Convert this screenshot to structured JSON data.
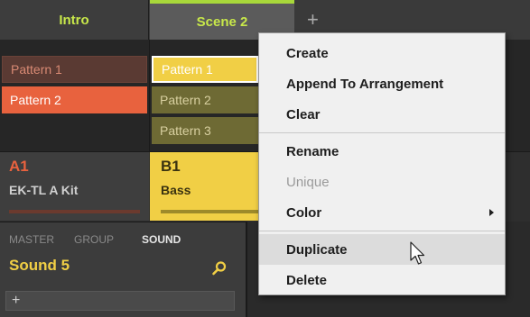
{
  "scenes": {
    "tabs": [
      {
        "label": "Intro"
      },
      {
        "label": "Scene 2"
      }
    ],
    "add_label": "+"
  },
  "patterns": {
    "col1": [
      "Pattern 1",
      "Pattern 2"
    ],
    "col2": [
      "Pattern 1",
      "Pattern 2",
      "Pattern 3"
    ]
  },
  "groups": {
    "a": {
      "id": "A1",
      "name": "EK-TL A Kit"
    },
    "b": {
      "id": "B1",
      "name": "Bass"
    }
  },
  "inspector": {
    "tabs": [
      "MASTER",
      "GROUP",
      "SOUND"
    ],
    "sound_name": "Sound 5",
    "add_label": "+"
  },
  "context_menu": {
    "items": [
      {
        "label": "Create",
        "enabled": true
      },
      {
        "label": "Append To Arrangement",
        "enabled": true
      },
      {
        "label": "Clear",
        "enabled": true
      },
      {
        "label": "Rename",
        "enabled": true
      },
      {
        "label": "Unique",
        "enabled": false
      },
      {
        "label": "Color",
        "enabled": true,
        "submenu": true
      },
      {
        "label": "Duplicate",
        "enabled": true,
        "hovered": true
      },
      {
        "label": "Delete",
        "enabled": true
      }
    ]
  },
  "colors": {
    "scene_label": "#c8e84a",
    "pattern_red": "#e8623e",
    "pattern_yellow": "#f1cf45",
    "pattern_olive": "#6e6a34",
    "group_a": "#e8623e",
    "group_b": "#f1cf45",
    "sound_name": "#f1cf45",
    "menu_bg": "#f0f0f0",
    "menu_hover": "#dcdcdc"
  },
  "icons": {
    "search": "search-icon",
    "submenu": "chevron-right-icon",
    "cursor": "mouse-pointer-icon"
  }
}
